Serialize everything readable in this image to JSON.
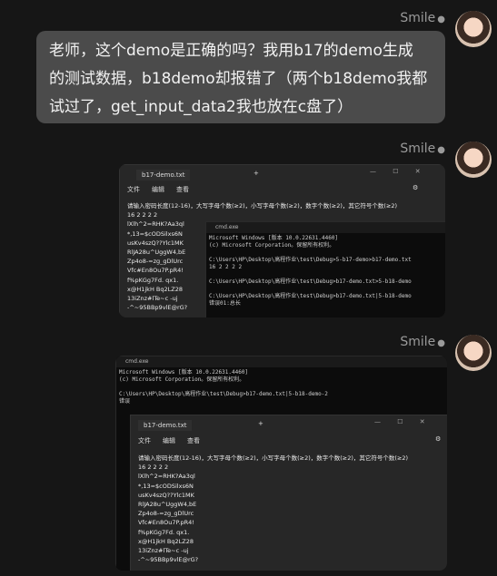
{
  "messages": [
    {
      "sender": "Smile",
      "text_lines": [
        "老师，这个demo是正确的吗？我用b17的demo生成",
        "的测试数据，b18demo却报错了（两个b18demo我都",
        "试过了，get_input_data2我也放在c盘了）"
      ]
    },
    {
      "sender": "Smile"
    },
    {
      "sender": "Smile"
    }
  ],
  "shot1": {
    "notepad": {
      "tab_title": "b17-demo.txt",
      "plus": "+",
      "menu": [
        "文件",
        "编辑",
        "查看"
      ],
      "content": "请输入密码长度(12-16)，大写字母个数(≥2)，小写字母个数(≥2)，数字个数(≥2)，其它符号个数(≥2)\n16 2 2 2 2\nlXlh^2=RHK?Aa3ql\n*,13=$cODSilxs6N\nusKv4szQ??Ylc1MK\nRlJA28u^UggW4,bE\nZp4o8-=zg_gDlUrc\nVfc#En8Ou7P.pR4!\nf%pKGg7Fd. qx1.\nx@H1jkH Bq2LZ28\n13iZnz#lTe~c -uj\n-^~95BBp9vlE@rG?"
    },
    "cmd": {
      "title": "cmd.exe",
      "lines": "Microsoft Windows [版本 10.0.22631.4460]\n(c) Microsoft Corporation。保留所有权利。\n\nC:\\Users\\HP\\Desktop\\高程作业\\test\\Debug>5-b17-demo>b17-demo.txt\n16 2 2 2 2\n\nC:\\Users\\HP\\Desktop\\高程作业\\test\\Debug>b17-demo.txt>5-b18-demo\n\nC:\\Users\\HP\\Desktop\\高程作业\\test\\Debug>b17-demo.txt|5-b18-demo\n错误01:总长"
    }
  },
  "shot2": {
    "cmd": {
      "title": "cmd.exe",
      "lines": "Microsoft Windows [版本 10.0.22631.4460]\n(c) Microsoft Corporation。保留所有权利。\n\nC:\\Users\\HP\\Desktop\\高程作业\\test\\Debug>b17-demo.txt|5-b18-demo-2\n错误"
    },
    "notepad": {
      "tab_title": "b17-demo.txt",
      "plus": "+",
      "menu": [
        "文件",
        "编辑",
        "查看"
      ],
      "content": "请输入密码长度(12-16)，大写字母个数(≥2)，小写字母个数(≥2)，数字个数(≥2)，其它符号个数(≥2)\n16 2 2 2 2\nlXlh^2=RHK?Aa3ql\n*,13=$cODSilxs6N\nusKv4szQ??Ylc1MK\nRlJA28u^UggW4,bE\nZp4o8-=zg_gDlUrc\nVfc#En8Ou7P.pR4!\nf%pKGg7Fd. qx1.\nx@H1jkH Bq2LZ28\n13iZnz#lTe~c -uj\n-^~95BBp9vlE@rG?"
    }
  },
  "window_controls": "— ☐ ✕",
  "gear": "⚙"
}
